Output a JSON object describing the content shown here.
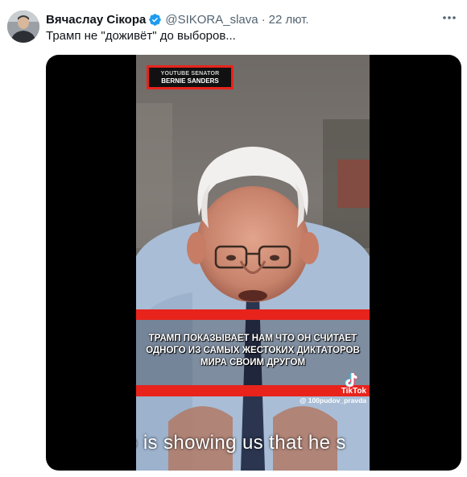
{
  "tweet": {
    "author_name": "Вячаслау Сікора",
    "handle": "@SIKORA_slava",
    "separator": "·",
    "timestamp": "22 лют.",
    "text": "Трамп не \"доживёт\" до выборов...",
    "verified_icon": "verified-badge-icon",
    "more_icon": "more-dots-icon"
  },
  "video": {
    "overlay_label_top": "YOUTUBE SENATOR",
    "overlay_label_name": "BERNIE SANDERS",
    "caption_line1": "ТРАМП ПОКАЗЫВАЕТ НАМ ЧТО ОН СЧИТАЕТ",
    "caption_line2": "ОДНОГО ИЗ САМЫХ ЖЕСТОКИХ ДИКТАТОРОВ",
    "caption_line3": "МИРА СВОИМ ДРУГОМ",
    "tiktok_brand": "TikTok",
    "tiktok_user": "@ 100pudov_pravda",
    "subtitle": "o is showing us that he s"
  },
  "colors": {
    "verified": "#1d9bf0",
    "overlay_red": "#e8231c",
    "secondary_text": "#536471"
  }
}
